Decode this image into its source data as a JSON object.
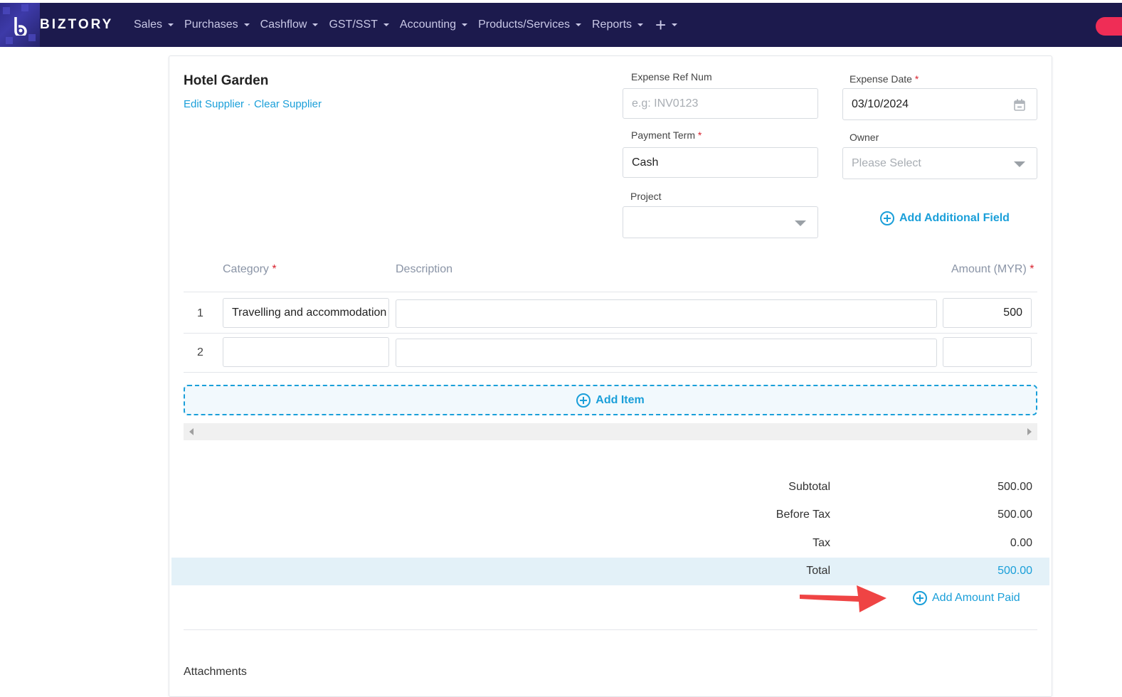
{
  "nav": {
    "brand": "BIZTORY",
    "menu": [
      "Sales",
      "Purchases",
      "Cashflow",
      "GST/SST",
      "Accounting",
      "Products/Services",
      "Reports"
    ],
    "plus_label": "+"
  },
  "supplier": {
    "name": "Hotel Garden",
    "edit_label": "Edit Supplier",
    "separator": "·",
    "clear_label": "Clear Supplier"
  },
  "fields": {
    "ref_label": "Expense Ref Num",
    "ref_placeholder": "e.g: INV0123",
    "date_label": "Expense Date",
    "date_value": "03/10/2024",
    "term_label": "Payment Term",
    "term_value": "Cash",
    "owner_label": "Owner",
    "owner_placeholder": "Please Select",
    "project_label": "Project",
    "add_field_label": "Add Additional Field",
    "required_mark": "*"
  },
  "table": {
    "headers": {
      "category": "Category",
      "description": "Description",
      "amount": "Amount (MYR)"
    },
    "rows": [
      {
        "num": "1",
        "category": "Travelling and accommodation",
        "description": "",
        "amount": "500"
      },
      {
        "num": "2",
        "category": "",
        "description": "",
        "amount": ""
      }
    ],
    "add_item_label": "Add Item"
  },
  "totals": {
    "subtotal_label": "Subtotal",
    "subtotal": "500.00",
    "before_tax_label": "Before Tax",
    "before_tax": "500.00",
    "tax_label": "Tax",
    "tax": "0.00",
    "total_label": "Total",
    "total": "500.00",
    "add_paid_label": "Add Amount Paid"
  },
  "attachments_label": "Attachments",
  "colors": {
    "nav_bg": "#1c1a4d",
    "accent": "#1a9fd9",
    "required": "#d8222e",
    "arrow": "#ef4444",
    "total_band": "#e3f1f8"
  }
}
